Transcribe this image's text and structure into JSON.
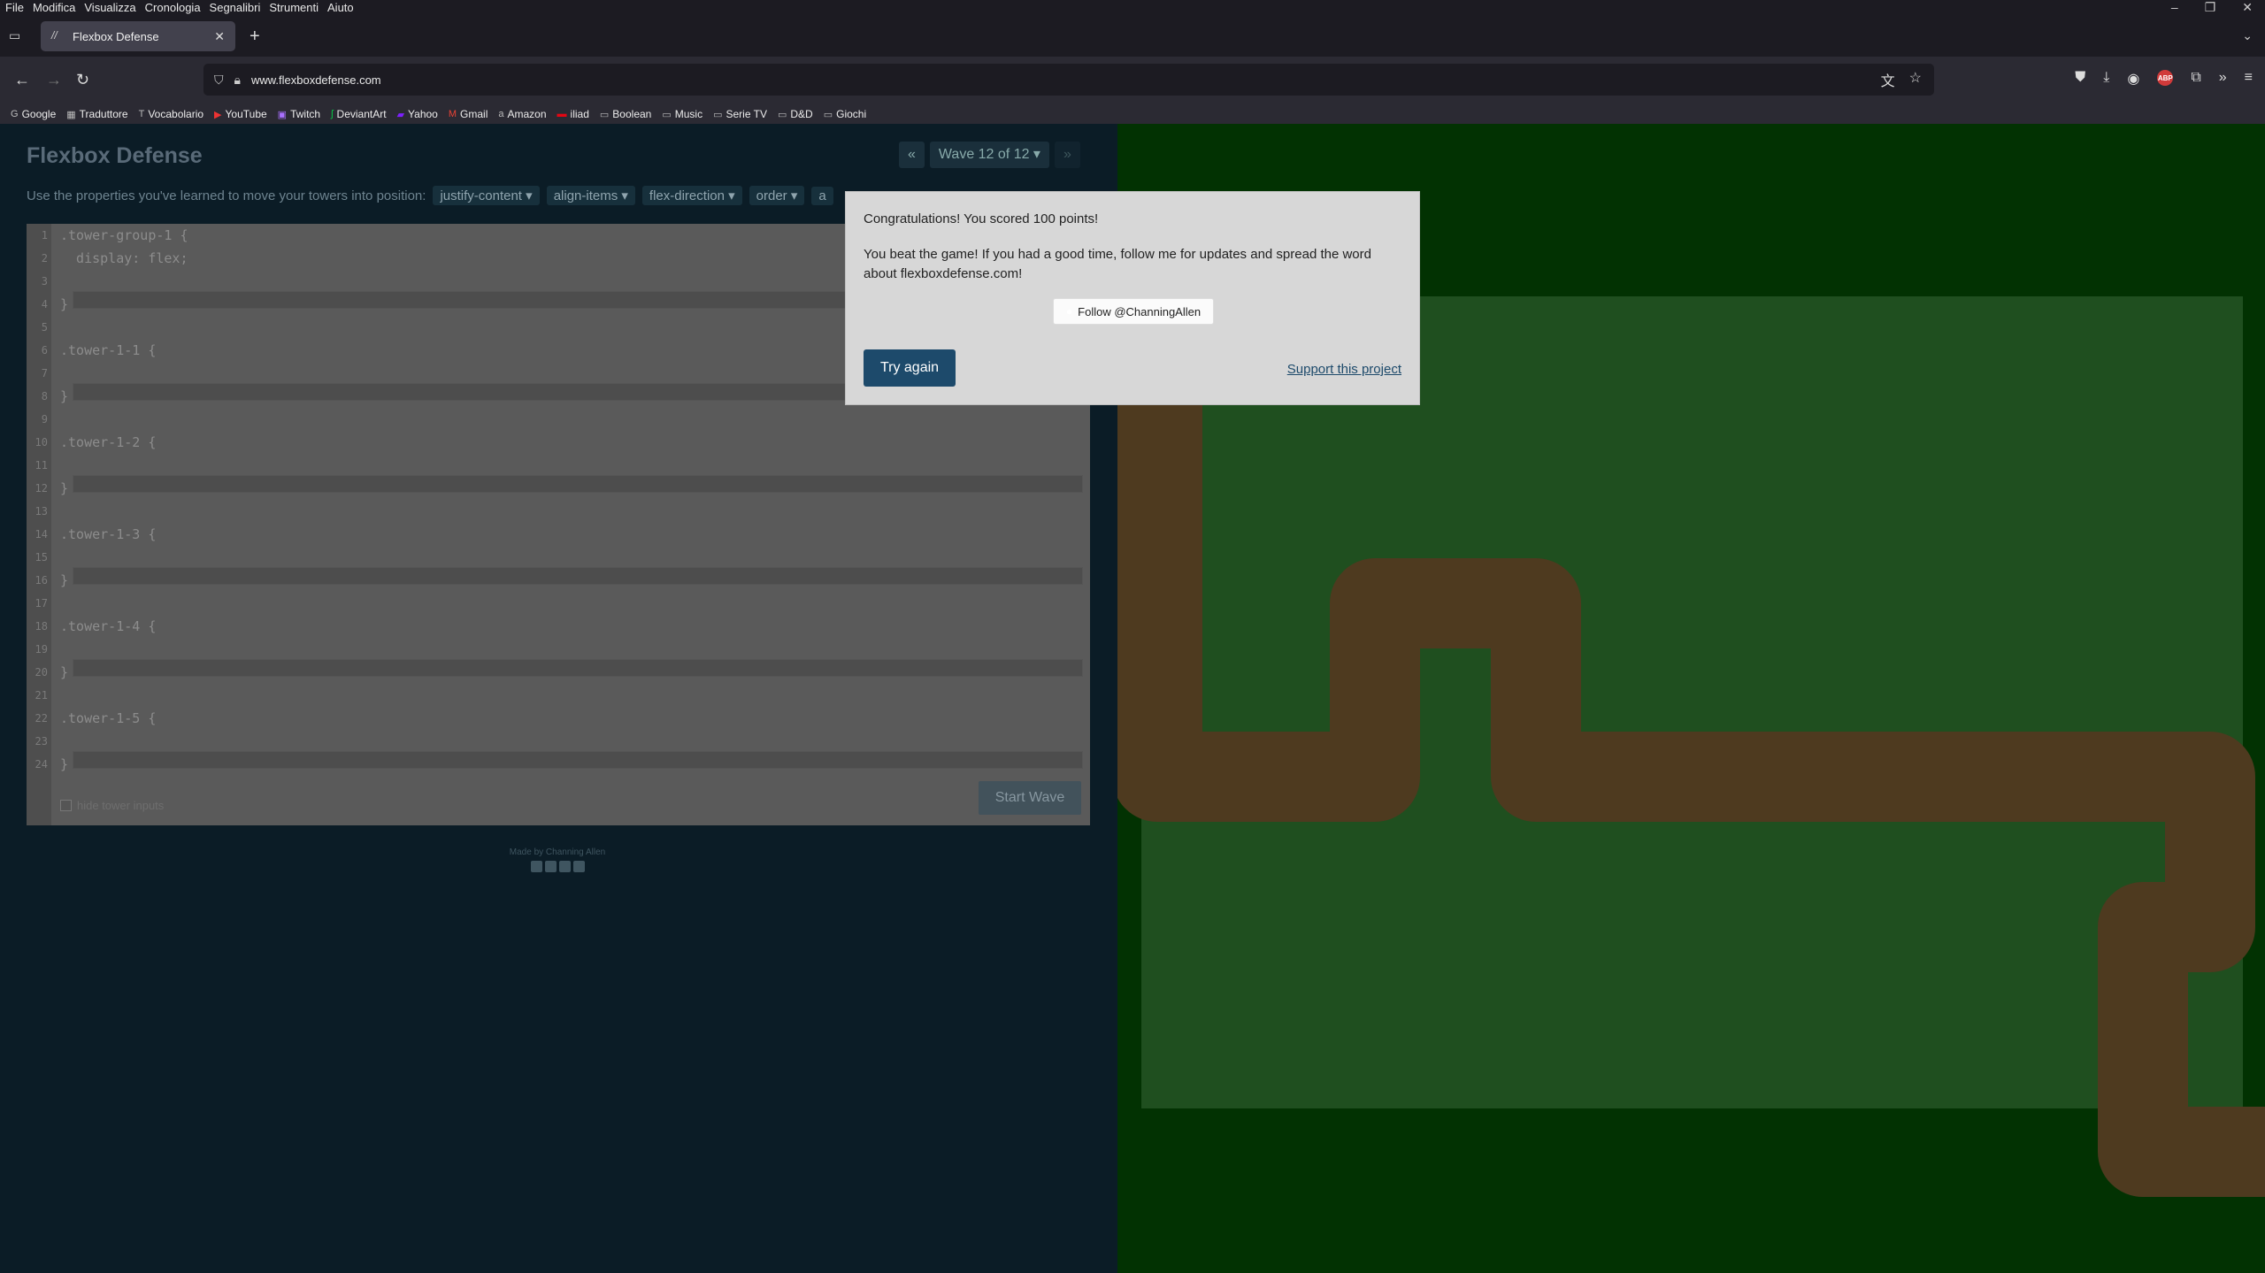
{
  "menubar": {
    "items": [
      "File",
      "Modifica",
      "Visualizza",
      "Cronologia",
      "Segnalibri",
      "Strumenti",
      "Aiuto"
    ],
    "window_controls": [
      "–",
      "❐",
      "✕"
    ]
  },
  "tab": {
    "title": "Flexbox Defense",
    "close": "✕",
    "new_tab": "+"
  },
  "address": {
    "url": "www.flexboxdefense.com"
  },
  "bookmarks": [
    {
      "icon": "G",
      "label": "Google"
    },
    {
      "icon": "▦",
      "label": "Traduttore"
    },
    {
      "icon": "T",
      "label": "Vocabolario"
    },
    {
      "icon": "▶",
      "label": "YouTube"
    },
    {
      "icon": "▣",
      "label": "Twitch"
    },
    {
      "icon": "ʃ",
      "label": "DeviantArt"
    },
    {
      "icon": "▰",
      "label": "Yahoo"
    },
    {
      "icon": "M",
      "label": "Gmail"
    },
    {
      "icon": "a",
      "label": "Amazon"
    },
    {
      "icon": "▬",
      "label": "iliad"
    },
    {
      "icon": "▭",
      "label": "Boolean"
    },
    {
      "icon": "▭",
      "label": "Music"
    },
    {
      "icon": "▭",
      "label": "Serie TV"
    },
    {
      "icon": "▭",
      "label": "D&D"
    },
    {
      "icon": "▭",
      "label": "Giochi"
    }
  ],
  "game": {
    "title": "Flexbox Defense",
    "wave_prev": "«",
    "wave_label": "Wave 12 of 12 ▾",
    "wave_next": "»",
    "instructions": "Use the properties you've learned to move your towers into position:",
    "properties": [
      "justify-content ▾",
      "align-items ▾",
      "flex-direction ▾",
      "order ▾",
      "a"
    ],
    "code_lines": [
      ".tower-group-1 {",
      "  display: flex;",
      "",
      "}",
      "",
      ".tower-1-1 {",
      "",
      "}",
      "",
      ".tower-1-2 {",
      "",
      "}",
      "",
      ".tower-1-3 {",
      "",
      "}",
      "",
      ".tower-1-4 {",
      "",
      "}",
      "",
      ".tower-1-5 {",
      "",
      "}"
    ],
    "line_numbers": [
      "1",
      "2",
      "3",
      "4",
      "5",
      "6",
      "7",
      "8",
      "9",
      "10",
      "11",
      "12",
      "13",
      "14",
      "15",
      "16",
      "17",
      "18",
      "19",
      "20",
      "21",
      "22",
      "23",
      "24"
    ],
    "start_wave": "Start Wave",
    "hide_inputs": "hide tower inputs",
    "credits": "Made by Channing Allen"
  },
  "modal": {
    "score_message": "Congratulations! You scored 100 points!",
    "beat_message": "You beat the game! If you had a good time, follow me for updates and spread the word about flexboxdefense.com!",
    "follow_button": "Follow @ChanningAllen",
    "try_again": "Try again",
    "support_link": "Support this project"
  },
  "colors": {
    "board_bg": "#023202",
    "grass": "#1f4f1f",
    "path": "#4e3a1f",
    "modal_accent": "#1d4a6b"
  }
}
